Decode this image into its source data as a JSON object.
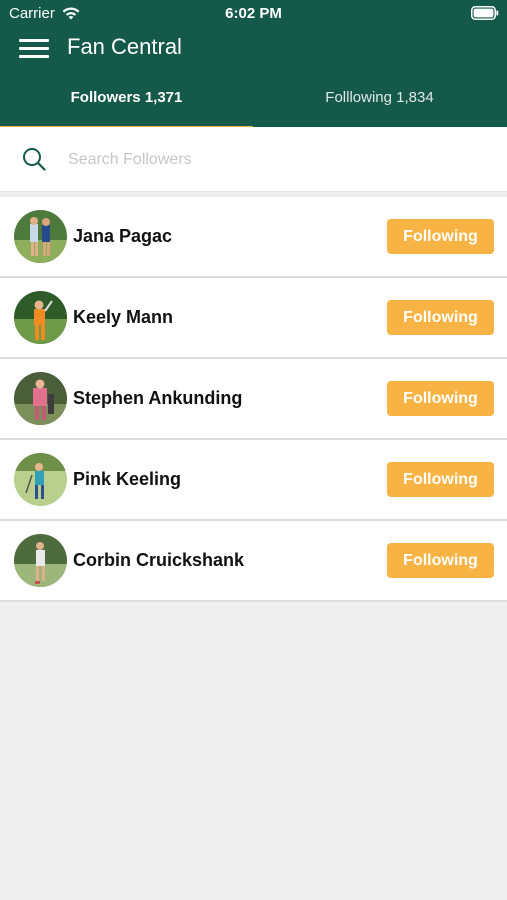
{
  "status_bar": {
    "carrier": "Carrier",
    "time": "6:02 PM"
  },
  "header": {
    "title": "Fan Central"
  },
  "tabs": [
    {
      "label": "Followers 1,371",
      "active": true
    },
    {
      "label": "Folllowing 1,834",
      "active": false
    }
  ],
  "search": {
    "placeholder": "Search Followers",
    "value": ""
  },
  "followers": [
    {
      "name": "Jana Pagac",
      "button": "Following"
    },
    {
      "name": "Keely Mann",
      "button": "Following"
    },
    {
      "name": "Stephen Ankunding",
      "button": "Following"
    },
    {
      "name": "Pink Keeling",
      "button": "Following"
    },
    {
      "name": "Corbin Cruickshank",
      "button": "Following"
    }
  ],
  "colors": {
    "header_bg": "#15594a",
    "tab_indicator": "#f2ad3c",
    "button_bg": "#f7b344",
    "page_bg": "#efefef"
  }
}
